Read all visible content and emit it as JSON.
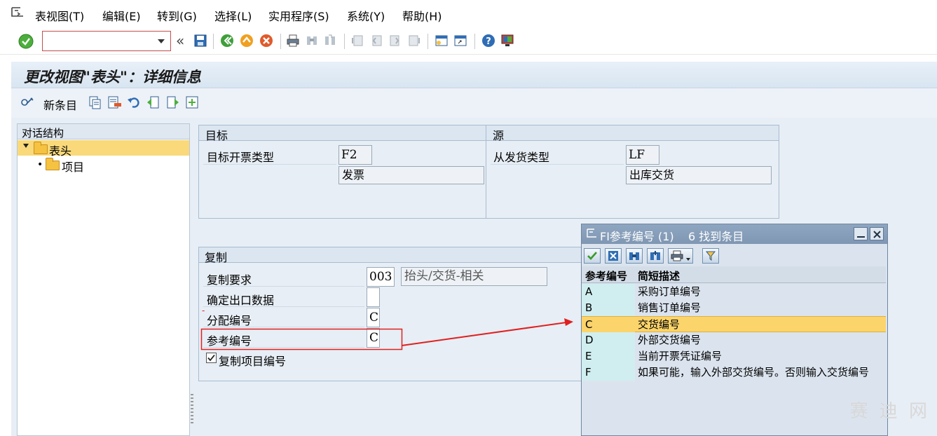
{
  "menu": {
    "items": [
      "表视图(T)",
      "编辑(E)",
      "转到(G)",
      "选择(L)",
      "实用程序(S)",
      "系统(Y)",
      "帮助(H)"
    ]
  },
  "toolbar": {
    "command_field_value": "",
    "icons": [
      "enter-icon",
      "save-icon",
      "back-icon",
      "exit-icon",
      "cancel-icon",
      "print-icon",
      "find-icon",
      "find-next-icon",
      "first-page-icon",
      "prev-page-icon",
      "next-page-icon",
      "last-page-icon",
      "new-session-icon",
      "shortcut-icon",
      "help-icon",
      "customize-layout-icon"
    ]
  },
  "page": {
    "title": "更改视图\"表头\"：详细信息"
  },
  "app_toolbar": {
    "new_entry": "新条目"
  },
  "dialog_structure": {
    "title": "对话结构",
    "items": [
      {
        "label": "表头",
        "expanded": true,
        "selected": true
      },
      {
        "label": "项目",
        "expanded": false,
        "selected": false
      }
    ]
  },
  "target_group": {
    "title": "目标",
    "field_label": "目标开票类型",
    "value": "F2",
    "description": "发票"
  },
  "source_group": {
    "title": "源",
    "field_label": "从发货类型",
    "value": "LF",
    "description": "出库交货"
  },
  "copy_group": {
    "title": "复制",
    "fields": [
      {
        "label": "复制要求",
        "value": "003",
        "description": "抬头/交货-相关"
      },
      {
        "label": "确定出口数据",
        "value": ""
      },
      {
        "label": "分配编号",
        "value": "C"
      },
      {
        "label": "参考编号",
        "value": "C"
      }
    ],
    "checkbox": {
      "label": "复制项目编号",
      "checked": true
    }
  },
  "popup": {
    "title": "FI参考编号 (1)",
    "count": "6 找到条目",
    "col_key": "参考编号",
    "col_desc": "简短描述",
    "rows": [
      {
        "key": "A",
        "desc": "采购订单编号",
        "selected": false
      },
      {
        "key": "B",
        "desc": "销售订单编号",
        "selected": false
      },
      {
        "key": "C",
        "desc": "交货编号",
        "selected": true
      },
      {
        "key": "D",
        "desc": "外部交货编号",
        "selected": false
      },
      {
        "key": "E",
        "desc": "当前开票凭证编号",
        "selected": false
      },
      {
        "key": "F",
        "desc": "如果可能，输入外部交货编号。否则输入交货编号",
        "selected": false
      }
    ]
  },
  "annotation": {
    "color": "#e02020"
  },
  "watermark": {
    "text": "赛 迪 网"
  }
}
